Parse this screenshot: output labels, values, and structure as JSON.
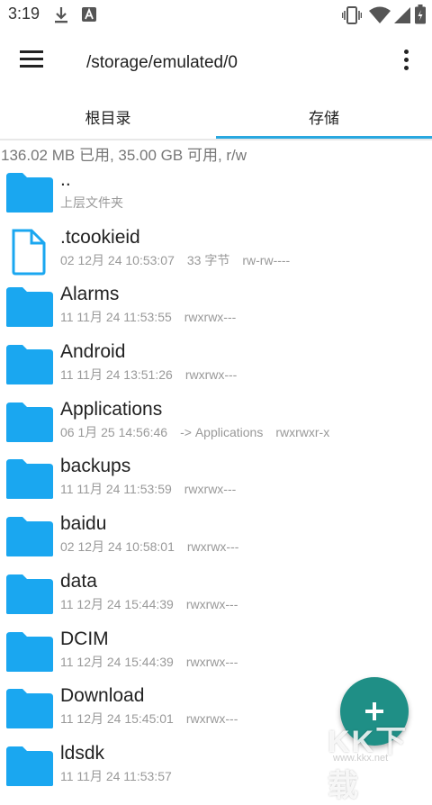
{
  "status_bar": {
    "time": "3:19"
  },
  "appbar": {
    "path": "/storage/emulated/0"
  },
  "tabs": [
    {
      "label": "根目录"
    },
    {
      "label": "存储"
    }
  ],
  "storage_info": "136.02 MB 已用, 35.00 GB 可用, r/w",
  "files": [
    {
      "name": "..",
      "meta": [
        "上层文件夹"
      ],
      "type": "folder"
    },
    {
      "name": ".tcookieid",
      "meta": [
        "02 12月 24 10:53:07",
        "33 字节",
        "rw-rw----"
      ],
      "type": "file"
    },
    {
      "name": "Alarms",
      "meta": [
        "11 11月 24 11:53:55",
        "rwxrwx---"
      ],
      "type": "folder"
    },
    {
      "name": "Android",
      "meta": [
        "11 11月 24 13:51:26",
        "rwxrwx---"
      ],
      "type": "folder"
    },
    {
      "name": "Applications",
      "meta": [
        "06 1月 25 14:56:46",
        "-> Applications",
        "rwxrwxr-x"
      ],
      "type": "folder"
    },
    {
      "name": "backups",
      "meta": [
        "11 11月 24 11:53:59",
        "rwxrwx---"
      ],
      "type": "folder"
    },
    {
      "name": "baidu",
      "meta": [
        "02 12月 24 10:58:01",
        "rwxrwx---"
      ],
      "type": "folder"
    },
    {
      "name": "data",
      "meta": [
        "11 12月 24 15:44:39",
        "rwxrwx---"
      ],
      "type": "folder"
    },
    {
      "name": "DCIM",
      "meta": [
        "11 12月 24 15:44:39",
        "rwxrwx---"
      ],
      "type": "folder"
    },
    {
      "name": "Download",
      "meta": [
        "11 12月 24 15:45:01",
        "rwxrwx---"
      ],
      "type": "folder"
    },
    {
      "name": "ldsdk",
      "meta": [
        "11 11月 24 11:53:57"
      ],
      "type": "folder"
    }
  ],
  "watermark": {
    "text": "KK下载",
    "url": "www.kkx.net"
  },
  "colors": {
    "accent": "#29a8e0",
    "folder": "#1aa7f0",
    "fab": "#1f8f86"
  }
}
